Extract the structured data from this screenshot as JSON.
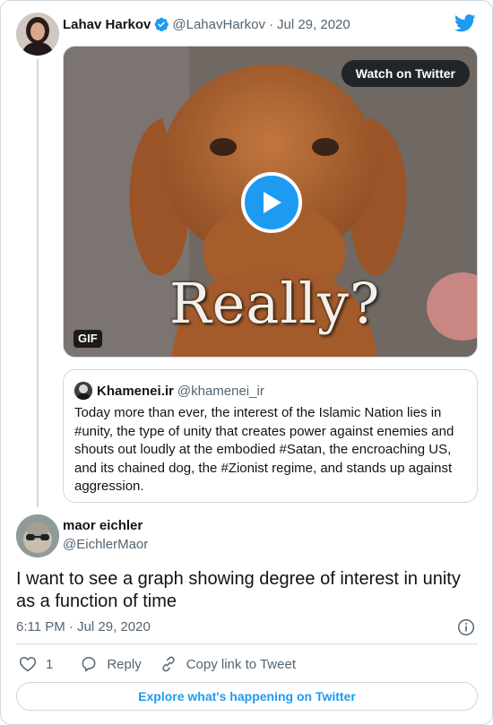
{
  "parent_tweet": {
    "author_name": "Lahav Harkov",
    "handle": "@LahavHarkov",
    "separator": "·",
    "date": "Jul 29, 2020",
    "media": {
      "watch_label": "Watch on Twitter",
      "gif_badge": "GIF",
      "overlay_text": "Really?"
    },
    "quoted": {
      "author_name": "Khamenei.ir",
      "handle": "@khamenei_ir",
      "text": "Today more than ever, the interest of the Islamic Nation lies in #unity, the type of unity that creates power against enemies and shouts out loudly at the embodied #Satan, the encroaching US, and its chained dog, the #Zionist regime, and stands up against aggression."
    }
  },
  "reply_tweet": {
    "author_name": "maor eichler",
    "handle": "@EichlerMaor",
    "text": "I want to see a graph showing degree of interest in unity as a function of time",
    "timestamp": "6:11 PM · Jul 29, 2020",
    "like_count": "1",
    "reply_label": "Reply",
    "copy_label": "Copy link to Tweet"
  },
  "explore_label": "Explore what's happening on Twitter",
  "colors": {
    "accent": "#1d9bf0",
    "text": "#0f1419",
    "muted": "#536471",
    "border": "#cfd9de"
  },
  "icons": [
    "twitter-bird-icon",
    "verified-badge-icon",
    "play-icon",
    "info-icon",
    "heart-icon",
    "reply-bubble-icon",
    "link-icon"
  ]
}
